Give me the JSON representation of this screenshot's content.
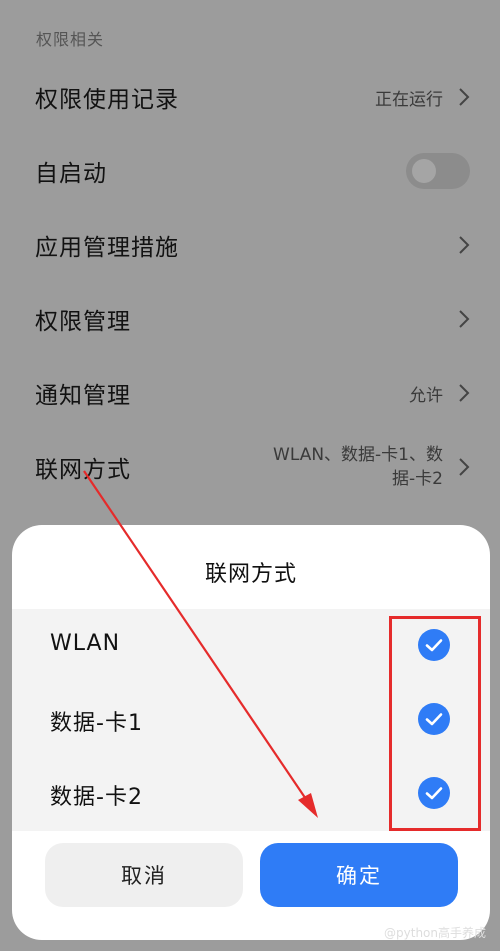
{
  "section": {
    "header": "权限相关"
  },
  "settings": {
    "permission_record": {
      "label": "权限使用记录",
      "value": "正在运行"
    },
    "autostart": {
      "label": "自启动",
      "enabled": false
    },
    "app_management": {
      "label": "应用管理措施"
    },
    "permission_management": {
      "label": "权限管理"
    },
    "notification_management": {
      "label": "通知管理",
      "value": "允许"
    },
    "network_mode": {
      "label": "联网方式",
      "value_line1": "WLAN、数据-卡1、数",
      "value_line2": "据-卡2"
    }
  },
  "dialog": {
    "title": "联网方式",
    "options": [
      {
        "label": "WLAN",
        "checked": true
      },
      {
        "label": "数据-卡1",
        "checked": true
      },
      {
        "label": "数据-卡2",
        "checked": true
      }
    ],
    "cancel_label": "取消",
    "confirm_label": "确定"
  },
  "colors": {
    "accent": "#2f7cf6",
    "annotation": "#e52b2b"
  },
  "watermark": "@python高手养成"
}
